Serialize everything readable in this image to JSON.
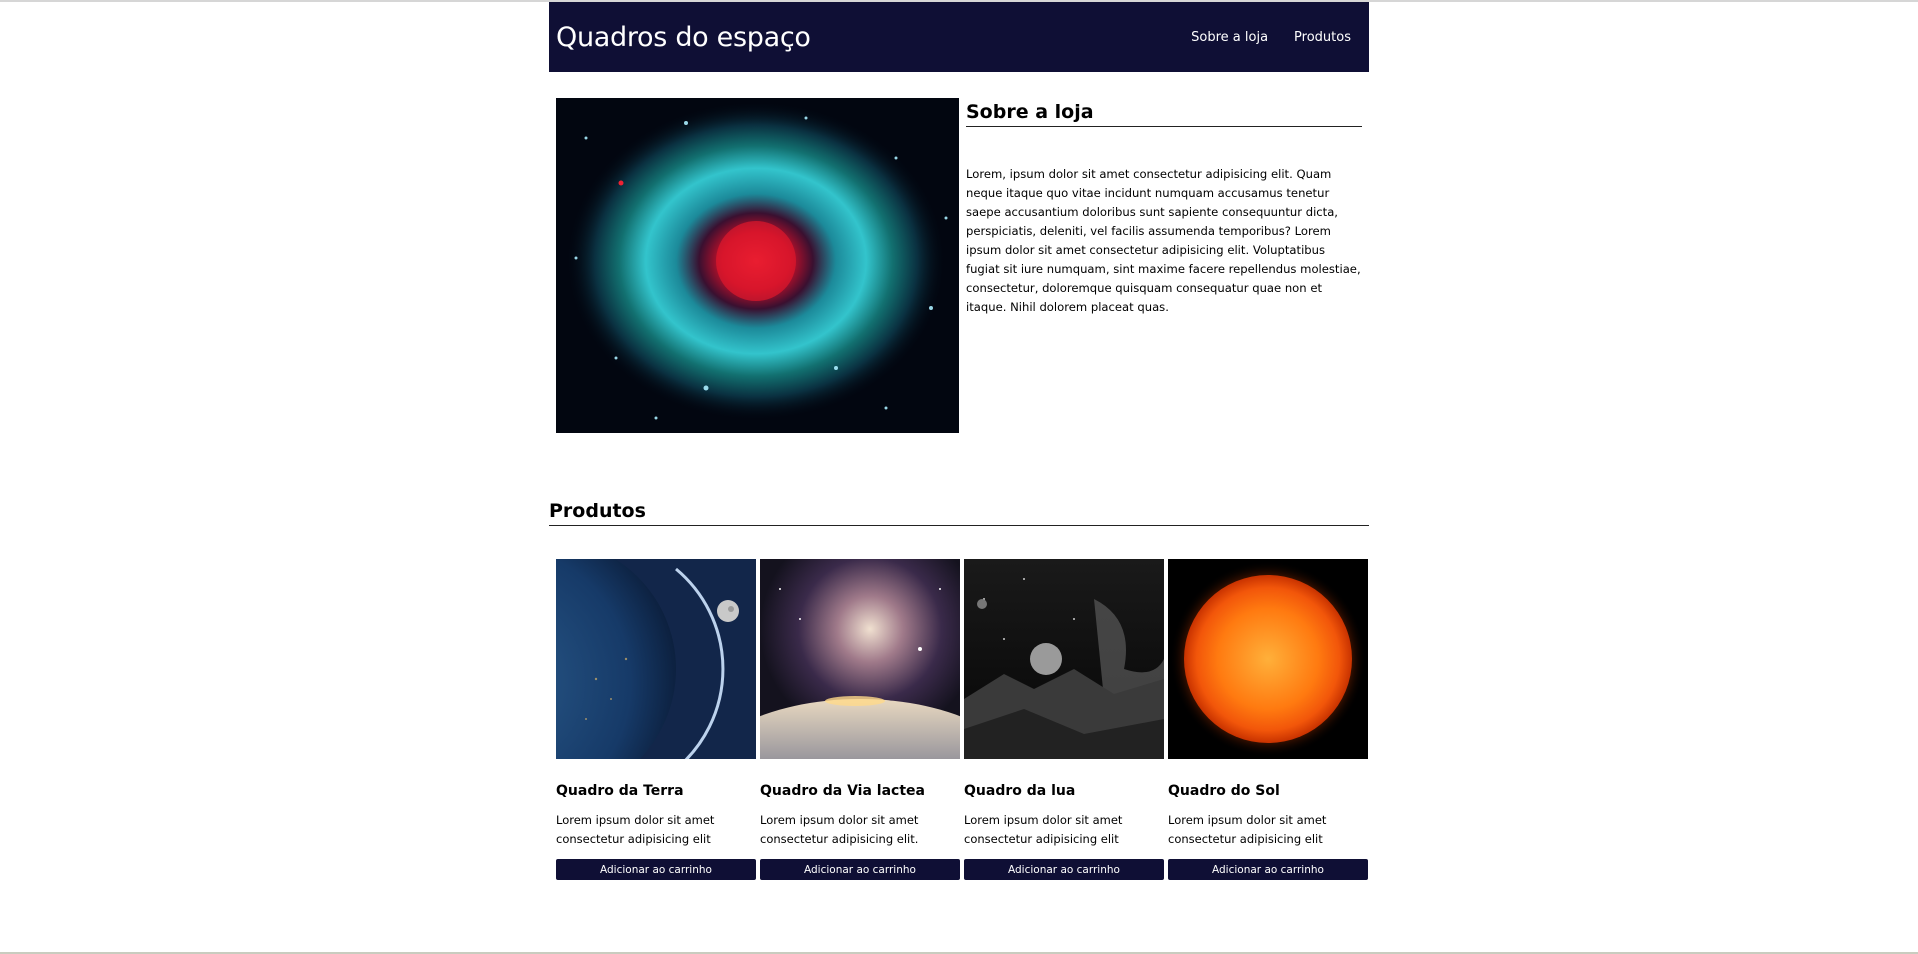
{
  "header": {
    "title": "Quadros do espaço",
    "nav": [
      "Sobre a loja",
      "Produtos"
    ]
  },
  "about": {
    "title": "Sobre a loja",
    "image_alt": "Nebulosa Hélice",
    "body": "Lorem, ipsum dolor sit amet consectetur adipisicing elit. Quam neque itaque quo vitae incidunt numquam accusamus tenetur saepe accusantium doloribus sunt sapiente consequuntur dicta, perspiciatis, deleniti, vel facilis assumenda temporibus? Lorem ipsum dolor sit amet consectetur adipisicing elit. Voluptatibus fugiat sit iure numquam, sint maxime facere repellendus molestiae, consectetur, doloremque quisquam consequatur quae non et itaque. Nihil dolorem placeat quas."
  },
  "products": {
    "title": "Produtos",
    "items": [
      {
        "name": "Quadro da Terra",
        "desc": "Lorem ipsum dolor sit amet consectetur adipisicing elit",
        "button": "Adicionar ao carrinho",
        "image": "earth-and-moon"
      },
      {
        "name": "Quadro da Via lactea",
        "desc": "Lorem ipsum dolor sit amet consectetur adipisicing elit.",
        "button": "Adicionar ao carrinho",
        "image": "milky-way-over-planet"
      },
      {
        "name": "Quadro da lua",
        "desc": "Lorem ipsum dolor sit amet consectetur adipisicing elit",
        "button": "Adicionar ao carrinho",
        "image": "moon-landscape"
      },
      {
        "name": "Quadro do Sol",
        "desc": "Lorem ipsum dolor sit amet consectetur adipisicing elit",
        "button": "Adicionar ao carrinho",
        "image": "sun"
      }
    ]
  },
  "colors": {
    "header_bg": "#0f0f35",
    "button_bg": "#0f0f35"
  }
}
